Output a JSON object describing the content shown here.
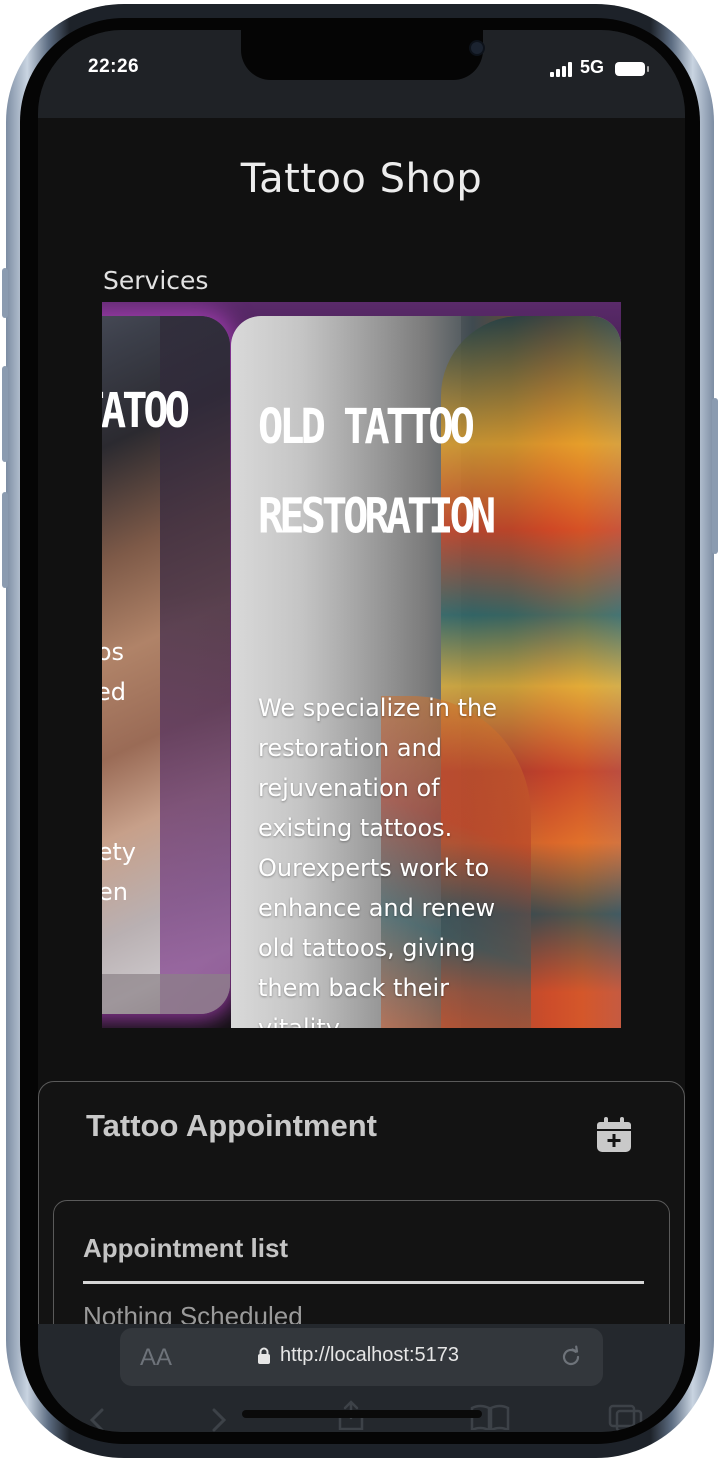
{
  "status_bar": {
    "time": "22:26",
    "network": "5G"
  },
  "app": {
    "title": "Tattoo Shop"
  },
  "services": {
    "label": "Services",
    "cards": [
      {
        "title_visible": "TATOO",
        "desc_fragments": [
          "os",
          "ed",
          "ety",
          "en"
        ]
      },
      {
        "title_line1": "OLD TATTOO",
        "title_line2": "RESTORATION",
        "description": "We specialize in the restoration and rejuvenation of existing tattoos. Ourexperts work to enhance and renew old tattoos, giving them back their vitality."
      }
    ]
  },
  "appointment": {
    "title": "Tattoo Appointment",
    "add_icon": "calendar-plus-icon",
    "list_title": "Appointment list",
    "empty_text": "Nothing Scheduled"
  },
  "browser": {
    "text_size_label": "AA",
    "url": "http://localhost:5173"
  }
}
